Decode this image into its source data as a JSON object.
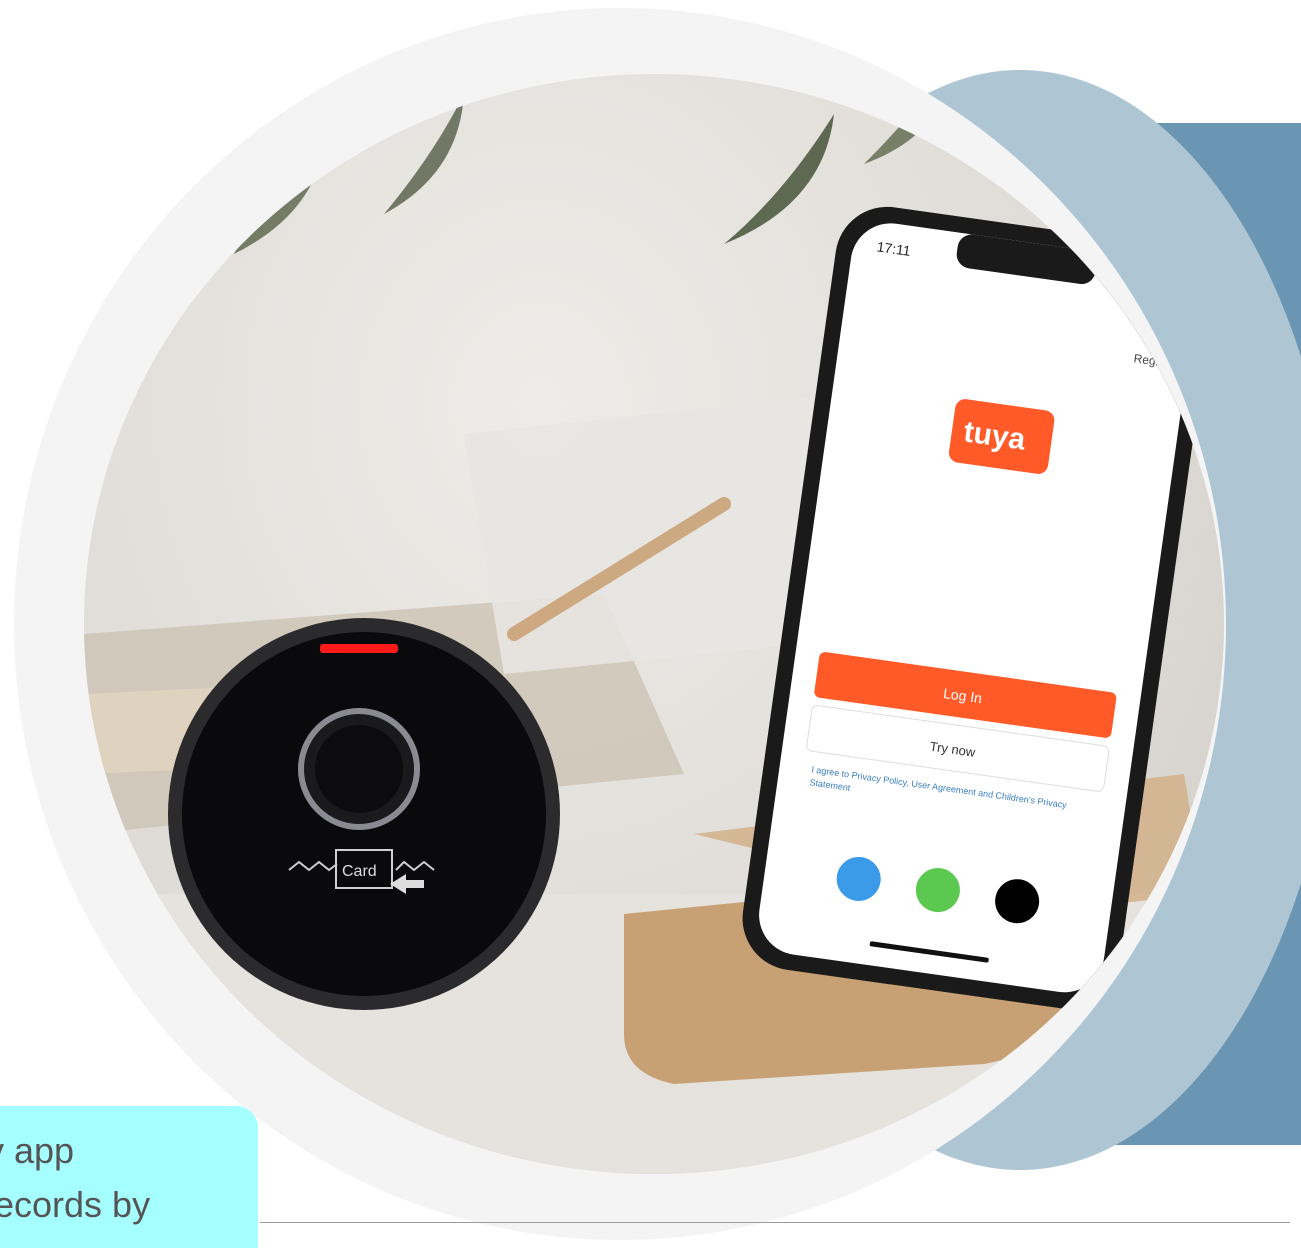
{
  "device": {
    "card_label": "Card"
  },
  "phone": {
    "time": "17:11",
    "register": "Register",
    "brand": "tuya",
    "login": "Log In",
    "try_now": "Try now",
    "legal": "I agree to Privacy Policy, User Agreement and Children's Privacy Statement"
  },
  "caption": {
    "line1": "y app",
    "line2": "records by"
  },
  "colors": {
    "panel": "#6a96b3",
    "accent": "#ff5a28",
    "caption_bg": "#a5ffff"
  }
}
